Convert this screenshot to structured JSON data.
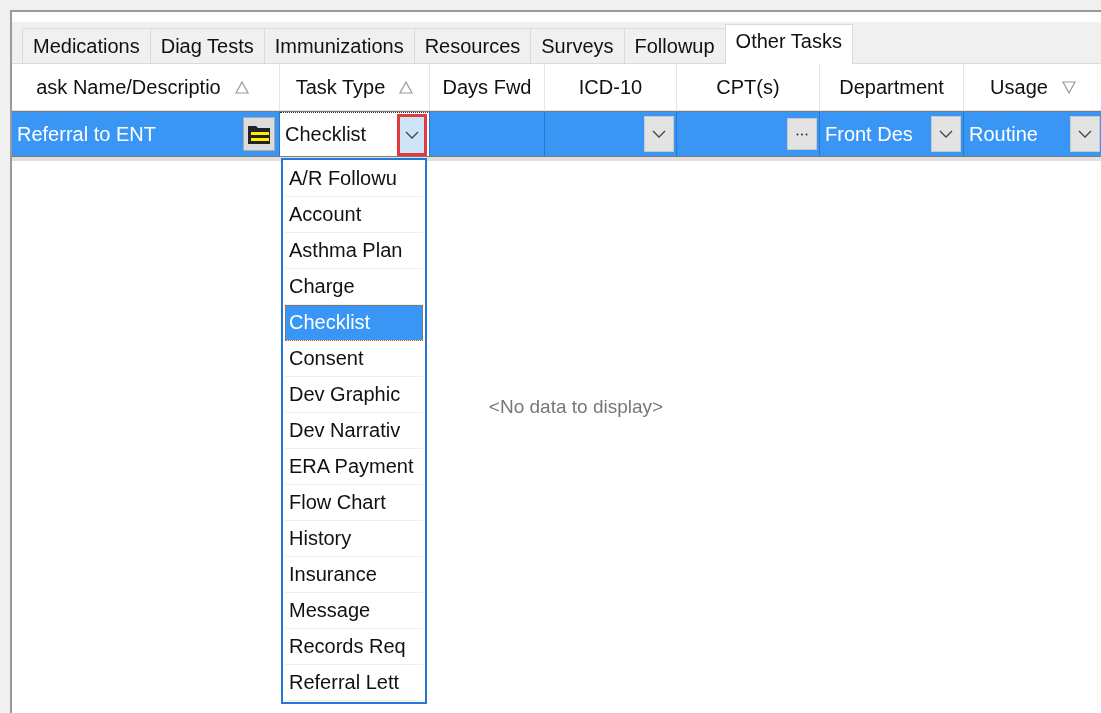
{
  "tabs": [
    {
      "label": "Medications",
      "selected": false
    },
    {
      "label": "Diag Tests",
      "selected": false
    },
    {
      "label": "Immunizations",
      "selected": false
    },
    {
      "label": "Resources",
      "selected": false
    },
    {
      "label": "Surveys",
      "selected": false
    },
    {
      "label": "Followup",
      "selected": false
    },
    {
      "label": "Other Tasks",
      "selected": true
    }
  ],
  "columns": [
    {
      "label": "ask Name/Descriptio",
      "kind": "ascending"
    },
    {
      "label": "Task Type",
      "kind": "ascending"
    },
    {
      "label": "Days Fwd",
      "kind": "unsorted"
    },
    {
      "label": "ICD-10",
      "kind": "unsorted"
    },
    {
      "label": "CPT(s)",
      "kind": "unsorted"
    },
    {
      "label": "Department",
      "kind": "unsorted"
    },
    {
      "label": "Usage",
      "kind": "descending"
    }
  ],
  "row": {
    "cells": [
      {
        "kind": "folder",
        "text": "Referral to ENT"
      },
      {
        "kind": "open-dropdown",
        "text": "Checklist"
      },
      {
        "kind": "plain"
      },
      {
        "kind": "dropdown"
      },
      {
        "kind": "ellipsis"
      },
      {
        "kind": "dropdown",
        "text": "Front Des"
      },
      {
        "kind": "dropdown",
        "text": "Routine"
      }
    ]
  },
  "dropdown_list": [
    {
      "label": "A/R Followu",
      "selected": false
    },
    {
      "label": "Account",
      "selected": false
    },
    {
      "label": "Asthma Plan",
      "selected": false
    },
    {
      "label": "Charge",
      "selected": false
    },
    {
      "label": "Checklist",
      "selected": true
    },
    {
      "label": "Consent",
      "selected": false
    },
    {
      "label": "Dev Graphic",
      "selected": false
    },
    {
      "label": "Dev Narrativ",
      "selected": false
    },
    {
      "label": "ERA Payment",
      "selected": false
    },
    {
      "label": "Flow Chart",
      "selected": false
    },
    {
      "label": "History",
      "selected": false
    },
    {
      "label": "Insurance",
      "selected": false
    },
    {
      "label": "Message",
      "selected": false
    },
    {
      "label": "Records Req",
      "selected": false
    },
    {
      "label": "Referral Lett",
      "selected": false
    }
  ],
  "empty_message": "<No data to display>"
}
